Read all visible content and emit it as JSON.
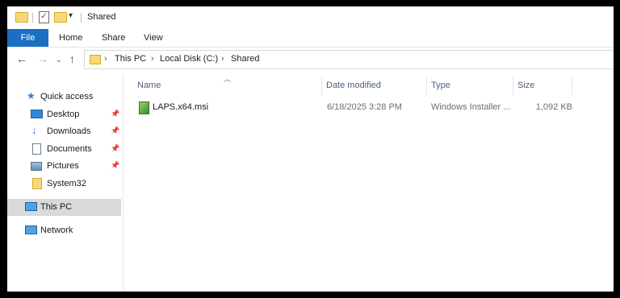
{
  "window": {
    "title": "Shared"
  },
  "ribbon": {
    "tabs": [
      "File",
      "Home",
      "Share",
      "View"
    ]
  },
  "address": {
    "breadcrumbs": [
      "This PC",
      "Local Disk (C:)",
      "Shared"
    ]
  },
  "sidebar": {
    "quick_access": "Quick access",
    "items": [
      {
        "label": "Desktop",
        "icon": "desktop-icon",
        "pinned": true
      },
      {
        "label": "Downloads",
        "icon": "downloads-icon",
        "pinned": true
      },
      {
        "label": "Documents",
        "icon": "documents-icon",
        "pinned": true
      },
      {
        "label": "Pictures",
        "icon": "pictures-icon",
        "pinned": true
      },
      {
        "label": "System32",
        "icon": "folder-icon",
        "pinned": false
      }
    ],
    "this_pc": "This PC",
    "network": "Network"
  },
  "columns": [
    "Name",
    "Date modified",
    "Type",
    "Size"
  ],
  "files": [
    {
      "name": "LAPS.x64.msi",
      "date": "6/18/2025 3:28 PM",
      "type": "Windows Installer ...",
      "size": "1,092 KB"
    }
  ],
  "colors": {
    "accent": "#1a6fc2",
    "folder": "#f8d775",
    "selected_bg": "#d9d9d9"
  }
}
